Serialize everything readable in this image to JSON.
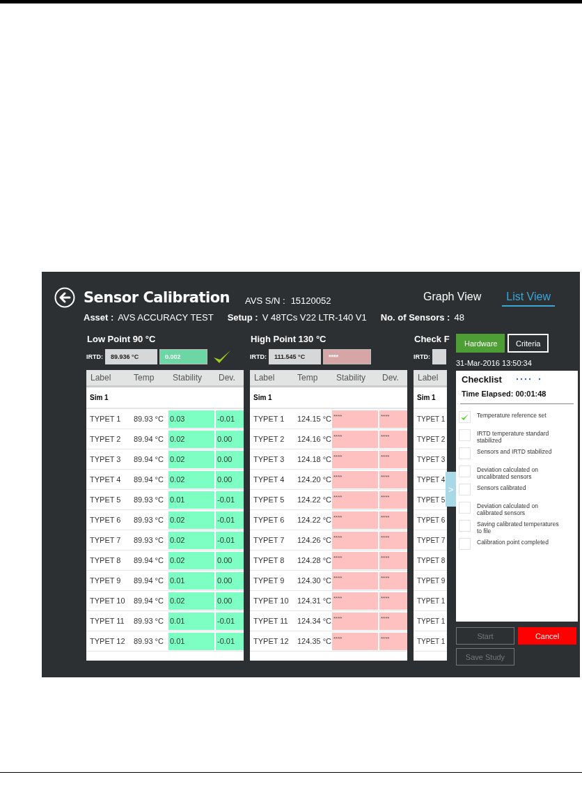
{
  "app": {
    "title": "Sensor Calibration",
    "serial": {
      "label": "AVS S/N :",
      "value": "15120052"
    },
    "views": [
      {
        "label": "Graph View",
        "selected": false
      },
      {
        "label": "List View",
        "selected": true
      }
    ],
    "info": [
      {
        "label": "Asset :",
        "value": "AVS ACCURACY TEST"
      },
      {
        "label": "Setup :",
        "value": "V 48TCs V22 LTR-140 V1"
      },
      {
        "label": "No. of Sensors :",
        "value": "48"
      }
    ],
    "points": [
      {
        "title": "Low Point  90 °C",
        "irtd_label": "IRTD:",
        "irtd": "89.936 °C",
        "stability": "0.002",
        "stable": true,
        "confirmed": true,
        "columns": [
          "Label",
          "Temp",
          "Stability",
          "Dev."
        ],
        "group": "Sim 1",
        "rows": [
          {
            "label": "TYPET 1",
            "temp": "89.93 °C",
            "stability": "0.03",
            "dev": "-0.01"
          },
          {
            "label": "TYPET 2",
            "temp": "89.94 °C",
            "stability": "0.02",
            "dev": "0.00"
          },
          {
            "label": "TYPET 3",
            "temp": "89.94 °C",
            "stability": "0.02",
            "dev": "0.00"
          },
          {
            "label": "TYPET 4",
            "temp": "89.94 °C",
            "stability": "0.02",
            "dev": "0.00"
          },
          {
            "label": "TYPET 5",
            "temp": "89.93 °C",
            "stability": "0.01",
            "dev": "-0.01"
          },
          {
            "label": "TYPET 6",
            "temp": "89.93 °C",
            "stability": "0.02",
            "dev": "-0.01"
          },
          {
            "label": "TYPET 7",
            "temp": "89.93 °C",
            "stability": "0.02",
            "dev": "-0.01"
          },
          {
            "label": "TYPET 8",
            "temp": "89.94 °C",
            "stability": "0.02",
            "dev": "0.00"
          },
          {
            "label": "TYPET 9",
            "temp": "89.94 °C",
            "stability": "0.01",
            "dev": "0.00"
          },
          {
            "label": "TYPET 10",
            "temp": "89.94 °C",
            "stability": "0.02",
            "dev": "0.00"
          },
          {
            "label": "TYPET 11",
            "temp": "89.93 °C",
            "stability": "0.01",
            "dev": "-0.01"
          },
          {
            "label": "TYPET 12",
            "temp": "89.93 °C",
            "stability": "0.01",
            "dev": "-0.01"
          }
        ]
      },
      {
        "title": "High Point  130 °C",
        "irtd_label": "IRTD:",
        "irtd": "111.545 °C",
        "stability": "****",
        "stable": false,
        "confirmed": false,
        "columns": [
          "Label",
          "Temp",
          "Stability",
          "Dev."
        ],
        "group": "Sim 1",
        "rows": [
          {
            "label": "TYPET 1",
            "temp": "124.15 °C",
            "stability": "****",
            "dev": "****"
          },
          {
            "label": "TYPET 2",
            "temp": "124.16 °C",
            "stability": "****",
            "dev": "****"
          },
          {
            "label": "TYPET 3",
            "temp": "124.18 °C",
            "stability": "****",
            "dev": "****"
          },
          {
            "label": "TYPET 4",
            "temp": "124.20 °C",
            "stability": "****",
            "dev": "****"
          },
          {
            "label": "TYPET 5",
            "temp": "124.22 °C",
            "stability": "****",
            "dev": "****"
          },
          {
            "label": "TYPET 6",
            "temp": "124.22 °C",
            "stability": "****",
            "dev": "****"
          },
          {
            "label": "TYPET 7",
            "temp": "124.26 °C",
            "stability": "****",
            "dev": "****"
          },
          {
            "label": "TYPET 8",
            "temp": "124.28 °C",
            "stability": "****",
            "dev": "****"
          },
          {
            "label": "TYPET 9",
            "temp": "124.30 °C",
            "stability": "****",
            "dev": "****"
          },
          {
            "label": "TYPET 10",
            "temp": "124.31 °C",
            "stability": "****",
            "dev": "****"
          },
          {
            "label": "TYPET 11",
            "temp": "124.34 °C",
            "stability": "****",
            "dev": "****"
          },
          {
            "label": "TYPET 12",
            "temp": "124.35 °C",
            "stability": "****",
            "dev": "****"
          }
        ]
      },
      {
        "title": "Check F",
        "irtd_label": "IRTD:",
        "columns": [
          "Label"
        ],
        "group": "Sim 1",
        "rows": [
          {
            "label": "TYPET 1"
          },
          {
            "label": "TYPET 2"
          },
          {
            "label": "TYPET 3"
          },
          {
            "label": "TYPET 4"
          },
          {
            "label": "TYPET 5"
          },
          {
            "label": "TYPET 6"
          },
          {
            "label": "TYPET 7"
          },
          {
            "label": "TYPET 8"
          },
          {
            "label": "TYPET 9"
          },
          {
            "label": "TYPET 1"
          },
          {
            "label": "TYPET 1"
          },
          {
            "label": "TYPET 1"
          }
        ]
      }
    ],
    "handle": ">",
    "modes": [
      {
        "label": "Hardware",
        "selected": true
      },
      {
        "label": "Criteria",
        "selected": false
      }
    ],
    "timestamp": "31-Mar-2016 13:50:34",
    "checklist": {
      "title": "Checklist",
      "elapsed": "Time Elapsed: 00:01:48",
      "items": [
        {
          "label": "Temperature reference set",
          "checked": true
        },
        {
          "label": "IRTD temperature standard stabilized",
          "checked": false
        },
        {
          "label": "Sensors and IRTD stabilized",
          "checked": false
        },
        {
          "label": "Deviation calculated on uncalibrated sensors",
          "checked": false
        },
        {
          "label": "Sensors calibrated",
          "checked": false
        },
        {
          "label": "Deviation calculated on calibrated sensors",
          "checked": false
        },
        {
          "label": "Saving calibrated temperatures to file",
          "checked": false
        },
        {
          "label": "Calibration point completed",
          "checked": false
        }
      ]
    },
    "actions": [
      {
        "label": "Start",
        "kind": "plain",
        "disabled": true
      },
      {
        "label": "Cancel",
        "kind": "danger",
        "disabled": false
      },
      {
        "label": "Save Study",
        "kind": "plain",
        "disabled": true
      }
    ]
  }
}
